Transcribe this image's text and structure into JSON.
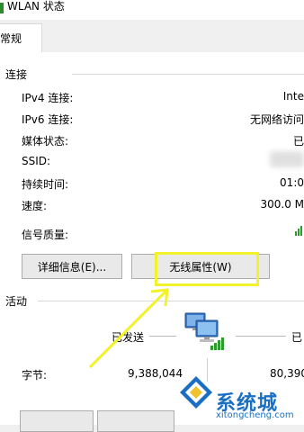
{
  "window": {
    "title": "WLAN 状态"
  },
  "tabs": [
    {
      "label": "常规"
    }
  ],
  "connection": {
    "group_title": "连接",
    "rows": [
      {
        "label": "IPv4 连接:",
        "value": "Inte"
      },
      {
        "label": "IPv6 连接:",
        "value": "无网络访问"
      },
      {
        "label": "媒体状态:",
        "value": "已"
      },
      {
        "label": "SSID:",
        "value": ""
      },
      {
        "label": "持续时间:",
        "value": "01:0"
      },
      {
        "label": "速度:",
        "value": "300.0 M"
      }
    ],
    "signal_label": "信号质量:"
  },
  "buttons": {
    "details": "详细信息(E)...",
    "wireless_properties": "无线属性(W)"
  },
  "activity": {
    "group_title": "活动",
    "sent_label": "已发送",
    "received_label": "已",
    "bytes_label": "字节:",
    "bytes_sent": "9,388,044",
    "bytes_received": "80,390"
  },
  "watermark": {
    "text": "系统城",
    "url": "xitongcheng.com"
  },
  "colors": {
    "highlight": "#f2f22a",
    "signal": "#2e9b2e",
    "watermark": "#1a6fc2"
  }
}
